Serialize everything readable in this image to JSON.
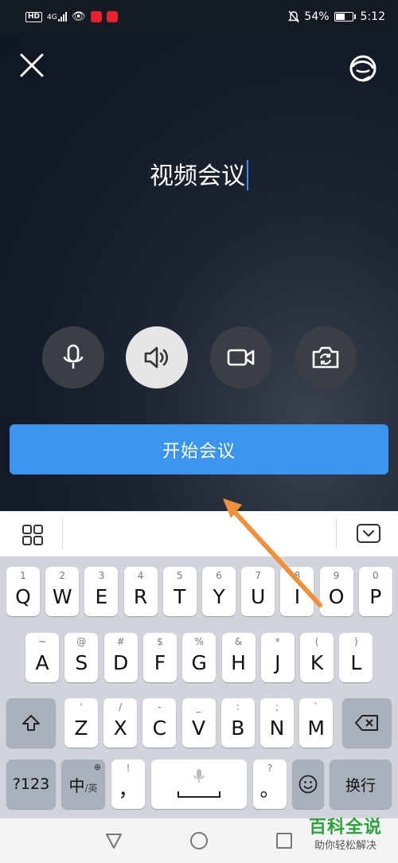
{
  "status_bar": {
    "hd_badge": "HD",
    "network_type": "4G",
    "battery_percent": "54%",
    "time": "5:12"
  },
  "meeting": {
    "title": "视频会议",
    "start_button_label": "开始会议",
    "speaker_active": true
  },
  "keyboard": {
    "row1": [
      {
        "hint": "1",
        "label": "Q"
      },
      {
        "hint": "2",
        "label": "W"
      },
      {
        "hint": "3",
        "label": "E"
      },
      {
        "hint": "4",
        "label": "R"
      },
      {
        "hint": "5",
        "label": "T"
      },
      {
        "hint": "6",
        "label": "Y"
      },
      {
        "hint": "7",
        "label": "U"
      },
      {
        "hint": "8",
        "label": "I"
      },
      {
        "hint": "9",
        "label": "O"
      },
      {
        "hint": "0",
        "label": "P"
      }
    ],
    "row2": [
      {
        "hint": "~",
        "label": "A"
      },
      {
        "hint": "@",
        "label": "S"
      },
      {
        "hint": "#",
        "label": "D"
      },
      {
        "hint": "$",
        "label": "F"
      },
      {
        "hint": "%",
        "label": "G"
      },
      {
        "hint": "&",
        "label": "H"
      },
      {
        "hint": "*",
        "label": "J"
      },
      {
        "hint": "(",
        "label": "K"
      },
      {
        "hint": ")",
        "label": "L"
      }
    ],
    "row3": [
      {
        "hint": "'",
        "label": "Z"
      },
      {
        "hint": "/",
        "label": "X"
      },
      {
        "hint": "-",
        "label": "C"
      },
      {
        "hint": "_",
        "label": "V"
      },
      {
        "hint": ":",
        "label": "B"
      },
      {
        "hint": ";",
        "label": "N"
      },
      {
        "hint": "`",
        "label": "M"
      }
    ],
    "numbers_label": "?123",
    "lang_label": "中",
    "lang_alt_label": "/英",
    "punct_hint": "!",
    "punct_label": "，",
    "period_hint": "?",
    "period_label": "。",
    "enter_label": "换行"
  },
  "watermark": {
    "main": "百科全说",
    "sub": "助你轻松解决"
  },
  "colors": {
    "accent_blue": "#3a94f0",
    "arrow_orange": "#f0903a",
    "watermark_green": "#2aa33a"
  }
}
